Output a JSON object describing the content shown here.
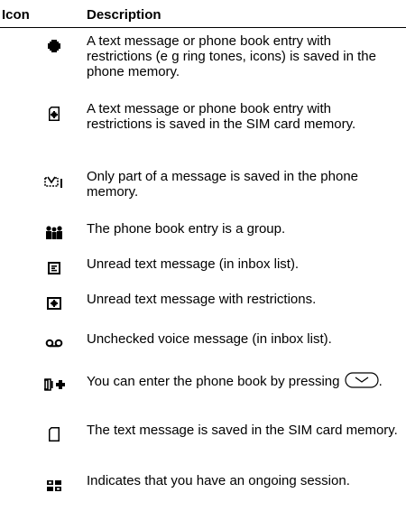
{
  "header": {
    "icon_label": "Icon",
    "description_label": "Description"
  },
  "rows": [
    {
      "icon": "restricted-phone-memory-icon",
      "text": "A text message or phone book entry with restrictions (e g ring tones, icons) is saved in the phone memory."
    },
    {
      "icon": "restricted-sim-card-icon",
      "text": "A text message or phone book entry with restrictions is saved in the SIM card memory."
    },
    {
      "icon": "partial-message-icon",
      "text": "Only part of a message is saved in the phone memory."
    },
    {
      "icon": "group-icon",
      "text": "The phone book entry is a group."
    },
    {
      "icon": "unread-message-icon",
      "text": "Unread text message (in inbox list)."
    },
    {
      "icon": "unread-restricted-message-icon",
      "text": "Unread text message with restrictions."
    },
    {
      "icon": "voicemail-icon",
      "text": "Unchecked voice message (in inbox list)."
    },
    {
      "icon": "phonebook-shortcut-icon",
      "text": "You can enter the phone book by pressing",
      "key_icon": "navigation-key-icon"
    },
    {
      "icon": "sim-card-icon",
      "text": "The text message is saved in the SIM card memory."
    },
    {
      "icon": "ongoing-session-icon",
      "text": "Indicates that you have an ongoing session."
    }
  ]
}
